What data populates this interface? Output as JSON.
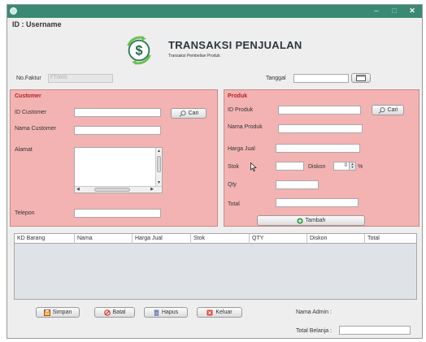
{
  "window": {
    "controls": {
      "minimize": "–",
      "maximize": "□",
      "close": "✕"
    }
  },
  "header": {
    "user_id": "ID : Username",
    "title": "TRANSAKSI PENJUALAN",
    "subtitle": "Transaksi Pembelian Produk",
    "logo_icon": "dollar-cycle-icon"
  },
  "top": {
    "faktur_label": "No.Faktur",
    "faktur_value": "FT0005",
    "tanggal_label": "Tanggal",
    "tanggal_value": "",
    "calendar_icon": "calendar-icon"
  },
  "customer": {
    "title": "Customer",
    "id_label": "ID Customer",
    "id_value": "",
    "cari_label": "Cari",
    "nama_label": "Nama Customer",
    "nama_value": "",
    "alamat_label": "Alamat",
    "alamat_value": "",
    "telepon_label": "Telepon",
    "telepon_value": ""
  },
  "produk": {
    "title": "Produk",
    "id_label": "ID Produk",
    "id_value": "",
    "cari_label": "Cari",
    "nama_label": "Nama Produk",
    "nama_value": "",
    "harga_label": "Harga Jual",
    "harga_value": "",
    "stok_label": "Stok",
    "stok_value": "",
    "diskon_label": "Diskon",
    "diskon_value": "0",
    "percent": "%",
    "qty_label": "Qty",
    "qty_value": "",
    "total_label": "Total",
    "total_value": "",
    "tambah_label": "Tambah"
  },
  "table": {
    "columns": [
      "KD Barang",
      "Nama",
      "Harga Jual",
      "Stok",
      "QTY",
      "Diskon",
      "Total"
    ],
    "rows": []
  },
  "actions": {
    "simpan": "Simpan",
    "batal": "Batal",
    "hapus": "Hapus",
    "keluar": "Keluar"
  },
  "footer": {
    "nama_admin_label": "Nama Admin :",
    "total_belanja_label": "Total Belanja :",
    "total_belanja_value": ""
  },
  "colors": {
    "titlebar": "#3a8a73",
    "panel_bg": "#f4b3b3",
    "panel_title": "#b02424",
    "tambah_icon": "#2e9a3e"
  }
}
